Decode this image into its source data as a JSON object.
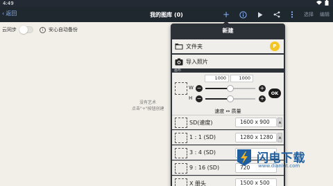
{
  "status_bar": {
    "time": "4:49"
  },
  "app_bar": {
    "back_label": "返回",
    "title": "我的图库 (0)",
    "select_label": "选择",
    "edit_label": "编辑"
  },
  "sync": {
    "label": "云同步",
    "safe_backup_label": "安心自动备份",
    "enabled": false
  },
  "empty_state": {
    "line1": "没有艺术",
    "line2": "点击\"+\"按钮创建"
  },
  "popover": {
    "title": "新建",
    "items": [
      {
        "label": "文件夹",
        "icon": "folder-icon",
        "badge": "P"
      },
      {
        "label": "导入照片",
        "icon": "camera-icon"
      }
    ],
    "section_label": "画布",
    "canvas_size": {
      "width_value": "1000",
      "height_value": "1000",
      "width_label": "W",
      "height_label": "H",
      "width_slider_fraction": 0.5,
      "height_slider_fraction": 0.5,
      "ok_label": "OK",
      "speed_quality_label": "速度 ↔ 质量"
    },
    "presets": [
      {
        "name": "SD(速度)",
        "value": "1600 x 900"
      },
      {
        "name": "1 : 1 (SD)",
        "value": "1280 x 1280"
      },
      {
        "name": "3 : 4 (SD)",
        "value": ""
      },
      {
        "name": "9 : 16 (SD)",
        "value": "720"
      },
      {
        "name": "X 册头",
        "value": "1500 x 500"
      }
    ]
  },
  "watermark": {
    "text": "闪电下载",
    "url": "www.dianlut.com"
  },
  "colors": {
    "app_bar_bg": "#1f272f",
    "accent": "#8ab4ff",
    "popover_bg": "#2c3137",
    "badge_yellow": "#f3c623"
  }
}
